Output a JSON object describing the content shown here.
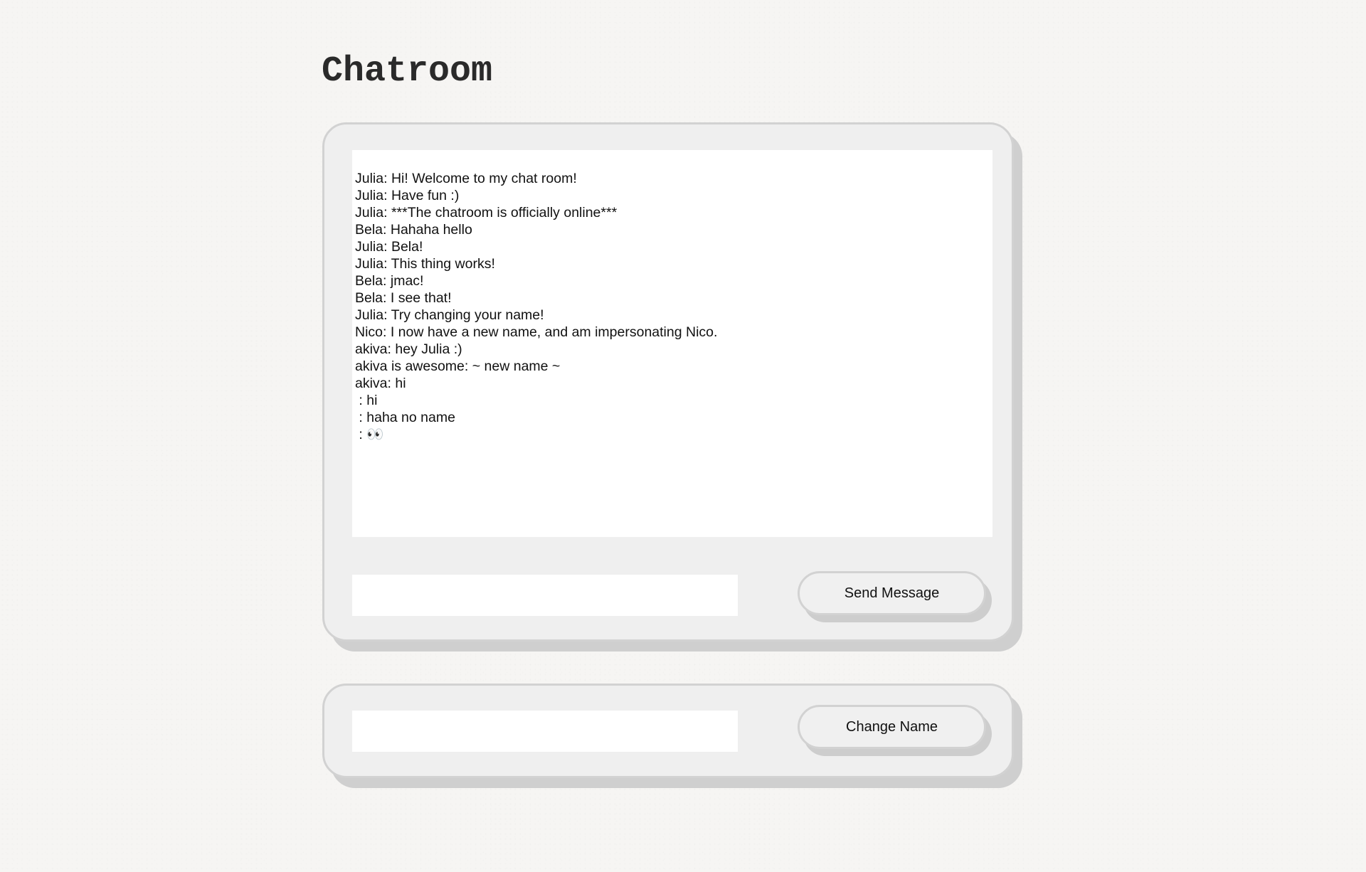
{
  "page": {
    "title": "Chatroom"
  },
  "chat": {
    "messages": [
      "Julia: Hi! Welcome to my chat room!",
      "Julia: Have fun :)",
      "Julia: ***The chatroom is officially online***",
      "Bela: Hahaha hello",
      "Julia: Bela!",
      "Julia: This thing works!",
      "Bela: jmac!",
      "Bela: I see that!",
      "Julia: Try changing your name!",
      "Nico: I now have a new name, and am impersonating Nico.",
      "akiva: hey Julia :)",
      "akiva is awesome: ~ new name ~",
      "akiva: hi",
      " : hi",
      " : haha no name",
      " : 👀"
    ],
    "message_input_value": "",
    "send_button_label": "Send Message"
  },
  "name": {
    "name_input_value": "",
    "change_button_label": "Change Name"
  },
  "colors": {
    "background": "#f6f5f3",
    "panel": "#efefef",
    "panel_border": "#d2d2d2",
    "panel_shadow": "#cfcfcf",
    "text": "#111111"
  }
}
